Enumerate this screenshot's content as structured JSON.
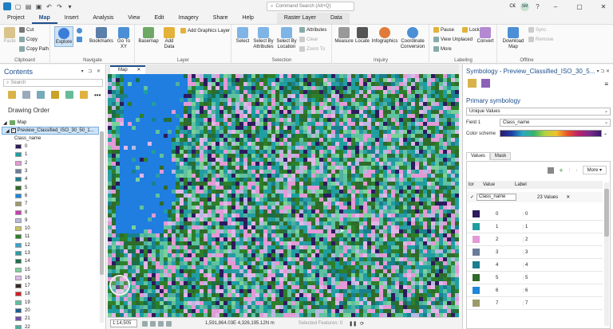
{
  "app": {
    "search_placeholder": "Command Search (Alt+Q)",
    "user_initials": "SM",
    "region_label": "C€"
  },
  "tabs": [
    "Project",
    "Map",
    "Insert",
    "Analysis",
    "View",
    "Edit",
    "Imagery",
    "Share",
    "Help",
    "Raster Layer",
    "Data"
  ],
  "active_tab": "Map",
  "ribbon": {
    "clipboard": {
      "label": "Clipboard",
      "paste": "Paste",
      "cut": "Cut",
      "copy": "Copy",
      "copy_path": "Copy Path"
    },
    "navigate": {
      "label": "Navigate",
      "explore": "Explore",
      "bookmarks": "Bookmarks",
      "goto": "Go To XY"
    },
    "layer": {
      "label": "Layer",
      "basemap": "Basemap",
      "add_data": "Add Data",
      "add_graphics": "Add Graphics Layer"
    },
    "selection": {
      "label": "Selection",
      "select": "Select",
      "by_attr": "Select By Attributes",
      "by_loc": "Select By Location",
      "attributes": "Attributes",
      "clear": "Clear",
      "zoom_to": "Zoom To"
    },
    "inquiry": {
      "label": "Inquiry",
      "measure": "Measure",
      "locate": "Locate",
      "infographics": "Infographics",
      "coordinate": "Coordinate Conversion"
    },
    "labeling": {
      "label": "Labeling",
      "pause": "Pause",
      "lock": "Lock",
      "view_unplaced": "View Unplaced",
      "more": "More",
      "convert": "Convert"
    },
    "offline": {
      "label": "Offline",
      "download": "Download Map",
      "sync": "Sync",
      "remove": "Remove"
    }
  },
  "contents": {
    "title": "Contents",
    "search_placeholder": "Search",
    "drawing_order": "Drawing Order",
    "map_name": "Map",
    "layer_name": "Preview_Classified_ISO_30_50_1...",
    "field_header": "Class_name",
    "legend": [
      {
        "label": "0",
        "color": "#2d1b5e"
      },
      {
        "label": "1",
        "color": "#1f9ea0"
      },
      {
        "label": "2",
        "color": "#e39ad6"
      },
      {
        "label": "3",
        "color": "#6a7d98"
      },
      {
        "label": "4",
        "color": "#1a7f8e"
      },
      {
        "label": "5",
        "color": "#2f6b2a"
      },
      {
        "label": "6",
        "color": "#1f86d9"
      },
      {
        "label": "7",
        "color": "#9c9a6a"
      },
      {
        "label": "8",
        "color": "#c93fb2"
      },
      {
        "label": "9",
        "color": "#b8b8e0"
      },
      {
        "label": "10",
        "color": "#c7c55a"
      },
      {
        "label": "11",
        "color": "#2d7f2a"
      },
      {
        "label": "12",
        "color": "#3aa0d0"
      },
      {
        "label": "13",
        "color": "#2c9ca6"
      },
      {
        "label": "14",
        "color": "#1a6f4a"
      },
      {
        "label": "15",
        "color": "#7bd19a"
      },
      {
        "label": "16",
        "color": "#e0b8e8"
      },
      {
        "label": "17",
        "color": "#3b2a2a"
      },
      {
        "label": "18",
        "color": "#d41f2a"
      },
      {
        "label": "19",
        "color": "#5fc2a0"
      },
      {
        "label": "20",
        "color": "#1b5e8e"
      },
      {
        "label": "21",
        "color": "#6a4fa8"
      },
      {
        "label": "22",
        "color": "#4fb0a0"
      }
    ]
  },
  "map": {
    "tab_label": "Map",
    "scale": "1:14,505",
    "coords": "1,591,864.03E 4,326,195.12N m",
    "selected_features": "Selected Features: 0"
  },
  "symbology": {
    "title": "Symbology - Preview_Classified_ISO_30_5...",
    "primary": "Primary symbology",
    "renderer": "Unique Values",
    "field_label": "Field 1",
    "field_value": "Class_name",
    "color_scheme_label": "Color scheme",
    "view_tabs": [
      "Values",
      "Mask"
    ],
    "more": "More",
    "col_color": "lor",
    "col_value": "Value",
    "col_label": "Label",
    "group_name": "Class_name",
    "group_count": "23 Values",
    "rows": [
      {
        "value": "0",
        "label": "0",
        "color": "#2d1b5e"
      },
      {
        "value": "1",
        "label": "1",
        "color": "#1f9ea0"
      },
      {
        "value": "2",
        "label": "2",
        "color": "#e39ad6"
      },
      {
        "value": "3",
        "label": "3",
        "color": "#6a7d98"
      },
      {
        "value": "4",
        "label": "4",
        "color": "#1a7f8e"
      },
      {
        "value": "5",
        "label": "5",
        "color": "#2f6b2a"
      },
      {
        "value": "6",
        "label": "6",
        "color": "#1f86d9"
      },
      {
        "value": "7",
        "label": "7",
        "color": "#9c9a6a"
      }
    ]
  },
  "palette": {
    "water": "#1f7ee0",
    "accent": "#1d4f8c"
  }
}
